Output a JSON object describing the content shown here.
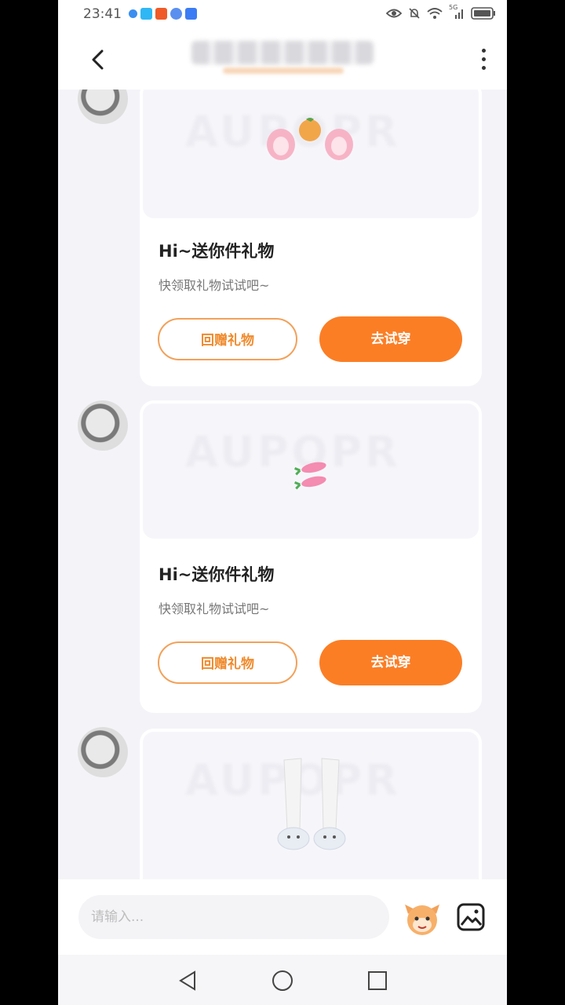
{
  "status_bar": {
    "time": "23:41",
    "signal_tag": "5G"
  },
  "header": {
    "title": ""
  },
  "messages": [
    {
      "card_title": "Hi~送你件礼物",
      "card_subtitle": "快领取礼物试试吧~",
      "return_gift_label": "回赠礼物",
      "try_on_label": "去试穿",
      "gift": "peach-ears-headband"
    },
    {
      "card_title": "Hi~送你件礼物",
      "card_subtitle": "快领取礼物试试吧~",
      "return_gift_label": "回赠礼物",
      "try_on_label": "去试穿",
      "gift": "carrot-hairclips"
    },
    {
      "gift": "white-leg-warmers-slippers"
    }
  ],
  "composer": {
    "placeholder": "请输入..."
  },
  "colors": {
    "accent": "#fb7e25",
    "accent_outline": "#f2a15a",
    "background": "#f4f4f8"
  }
}
